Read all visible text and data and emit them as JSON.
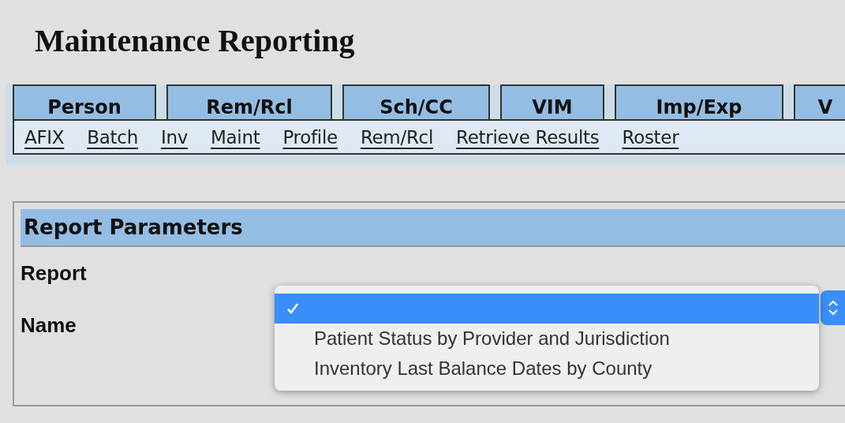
{
  "page": {
    "title": "Maintenance Reporting"
  },
  "tabs": [
    {
      "label": "Person"
    },
    {
      "label": "Rem/Rcl"
    },
    {
      "label": "Sch/CC"
    },
    {
      "label": "VIM"
    },
    {
      "label": "Imp/Exp"
    },
    {
      "label": "V"
    }
  ],
  "subnav": [
    "AFIX",
    "Batch",
    "Inv",
    "Maint",
    "Profile",
    "Rem/Rcl",
    "Retrieve Results",
    "Roster"
  ],
  "panel": {
    "title": "Report Parameters",
    "fields": [
      {
        "label": "Report"
      },
      {
        "label": "Name"
      }
    ]
  },
  "dropdown": {
    "options": [
      {
        "selected": true
      },
      {
        "label": "Patient Status by Provider and Jurisdiction",
        "selected": false
      },
      {
        "label": "Inventory Last Balance Dates by County",
        "selected": false
      }
    ]
  }
}
